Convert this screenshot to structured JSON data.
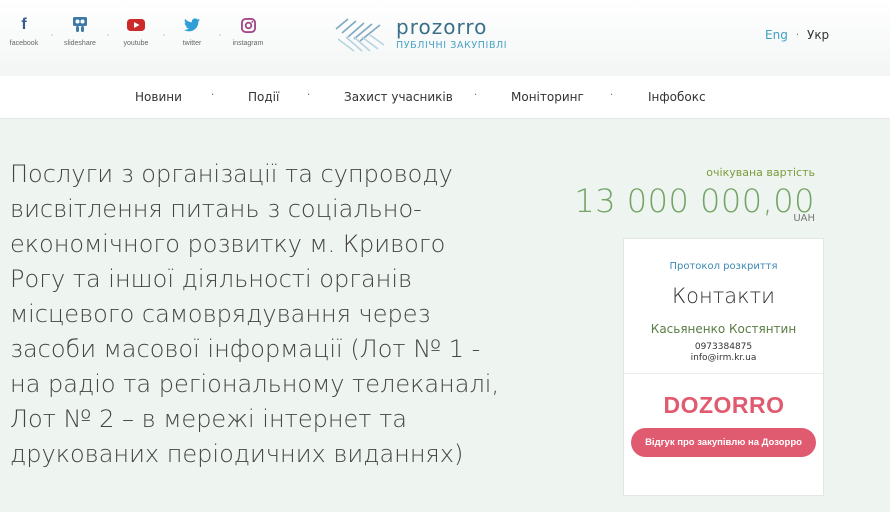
{
  "social": [
    {
      "label": "facebook",
      "icon": "facebook-icon"
    },
    {
      "label": "slideshare",
      "icon": "slideshare-icon"
    },
    {
      "label": "youtube",
      "icon": "youtube-icon"
    },
    {
      "label": "twitter",
      "icon": "twitter-icon"
    },
    {
      "label": "instagram",
      "icon": "instagram-icon"
    }
  ],
  "logo": {
    "name": "prozorro",
    "subtitle": "ПУБЛІЧНІ ЗАКУПІВЛІ"
  },
  "lang": {
    "en": "Eng",
    "uk": "Укр"
  },
  "nav": [
    "Новини",
    "Події",
    "Захист учасників",
    "Моніторинг",
    "Інфобокс"
  ],
  "tender": {
    "title": "Послуги з організації та супроводу висвітлення питань з соціально-економічного розвитку м. Кривого Рогу та іншої діяльності органів місцевого самоврядування через засоби масової інформації (Лот № 1 - на радіо та регіональному телеканалі, Лот № 2 – в мережі інтернет та друкованих періодичних виданнях)",
    "price_label": "очікувана вартість",
    "price_value": "13 000 000,00",
    "currency": "UAH"
  },
  "card": {
    "protocol_link": "Протокол розкриття",
    "contacts_title": "Контакти",
    "contact_name": "Касьяненко Костянтин",
    "contact_phone": "0973384875",
    "contact_email": "info@irm.kr.ua",
    "dozorro_logo": "DOZORRO",
    "dozorro_button": "Відгук про закупівлю на Дозорро"
  },
  "colors": {
    "accent_blue": "#3c9fc4",
    "price_green": "#73a365",
    "dozorro_red": "#e05a70",
    "background": "#eef4ef"
  }
}
